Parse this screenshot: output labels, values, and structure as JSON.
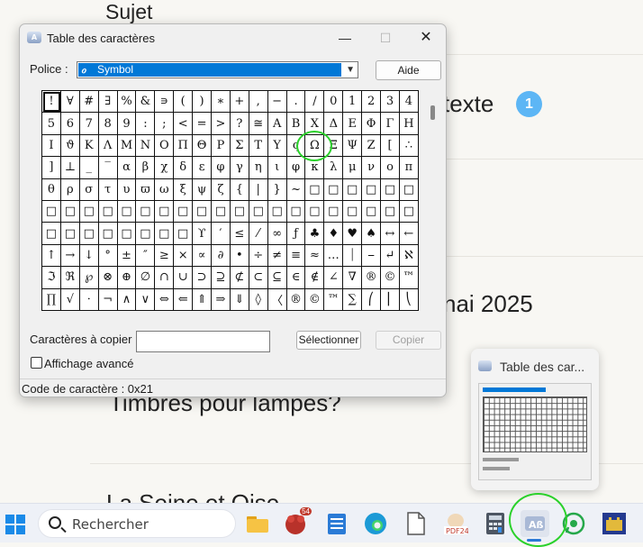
{
  "background": {
    "heading": "Sujet",
    "partial_text": "texte",
    "badge": "1",
    "date_partial": "nai 2025",
    "question": "Timbres pour lampes?",
    "bottom_text": "La Seine et Oise"
  },
  "dialog": {
    "title": "Table des caractères",
    "font_label": "Police :",
    "font_value": "Symbol",
    "help_button": "Aide",
    "chars_to_copy_label": "Caractères à copier",
    "select_button": "Sélectionner",
    "copy_button": "Copier",
    "advanced_view_label": "Affichage avancé",
    "status": "Code de caractère : 0x21",
    "window_buttons": {
      "minimize": "—",
      "maximize": "☐",
      "close": "✕"
    },
    "characters": [
      "!",
      "∀",
      "#",
      "∃",
      "%",
      "&",
      "∍",
      "(",
      ")",
      "∗",
      "+",
      ",",
      "−",
      ".",
      "/",
      "0",
      "1",
      "2",
      "3",
      "4",
      "5",
      "6",
      "7",
      "8",
      "9",
      ":",
      ";",
      "<",
      "=",
      ">",
      "?",
      "≅",
      "Α",
      "Β",
      "Χ",
      "Δ",
      "Ε",
      "Φ",
      "Γ",
      "Η",
      "Ι",
      "ϑ",
      "Κ",
      "Λ",
      "Μ",
      "Ν",
      "Ο",
      "Π",
      "Θ",
      "Ρ",
      "Σ",
      "Τ",
      "Υ",
      "ς",
      "Ω",
      "Ξ",
      "Ψ",
      "Ζ",
      "[",
      "∴",
      "]",
      "⊥",
      "_",
      "‾",
      "α",
      "β",
      "χ",
      "δ",
      "ε",
      "φ",
      "γ",
      "η",
      "ι",
      "φ",
      "κ",
      "λ",
      "μ",
      "ν",
      "ο",
      "π",
      "θ",
      "ρ",
      "σ",
      "τ",
      "υ",
      "ϖ",
      "ω",
      "ξ",
      "ψ",
      "ζ",
      "{",
      "|",
      "}",
      "~",
      "□",
      "□",
      "□",
      "□",
      "□",
      "□",
      "□",
      "□",
      "□",
      "□",
      "□",
      "□",
      "□",
      "□",
      "□",
      "□",
      "□",
      "□",
      "□",
      "□",
      "□",
      "□",
      "□",
      "□",
      "□",
      "□",
      "□",
      "□",
      "□",
      "□",
      "□",
      "□",
      "□",
      "□",
      "ϒ",
      "′",
      "≤",
      "⁄",
      "∞",
      "ƒ",
      "♣",
      "♦",
      "♥",
      "♠",
      "↔",
      "←",
      "↑",
      "→",
      "↓",
      "°",
      "±",
      "″",
      "≥",
      "×",
      "∝",
      "∂",
      "•",
      "÷",
      "≠",
      "≡",
      "≈",
      "…",
      "⏐",
      "⎯",
      "↵",
      "ℵ",
      "ℑ",
      "ℜ",
      "℘",
      "⊗",
      "⊕",
      "∅",
      "∩",
      "∪",
      "⊃",
      "⊇",
      "⊄",
      "⊂",
      "⊆",
      "∈",
      "∉",
      "∠",
      "∇",
      "®",
      "©",
      "™",
      "∏",
      "√",
      "⋅",
      "¬",
      "∧",
      "∨",
      "⇔",
      "⇐",
      "⇑",
      "⇒",
      "⇓",
      "◊",
      "〈",
      "®",
      "©",
      "™",
      "∑",
      "⎛",
      "⎜",
      "⎝"
    ]
  },
  "preview": {
    "title": "Table des car..."
  },
  "taskbar": {
    "search_placeholder": "Rechercher",
    "apps": [
      "file-explorer",
      "game-app",
      "notepad",
      "edge-browser",
      "blank-document",
      "pdf24",
      "calculator",
      "character-map",
      "whatsapp",
      "castle-app"
    ],
    "game_badge": "54"
  },
  "colors": {
    "accent": "#0078d7",
    "highlight": "#2bd12b",
    "badge": "#5db6f5"
  }
}
